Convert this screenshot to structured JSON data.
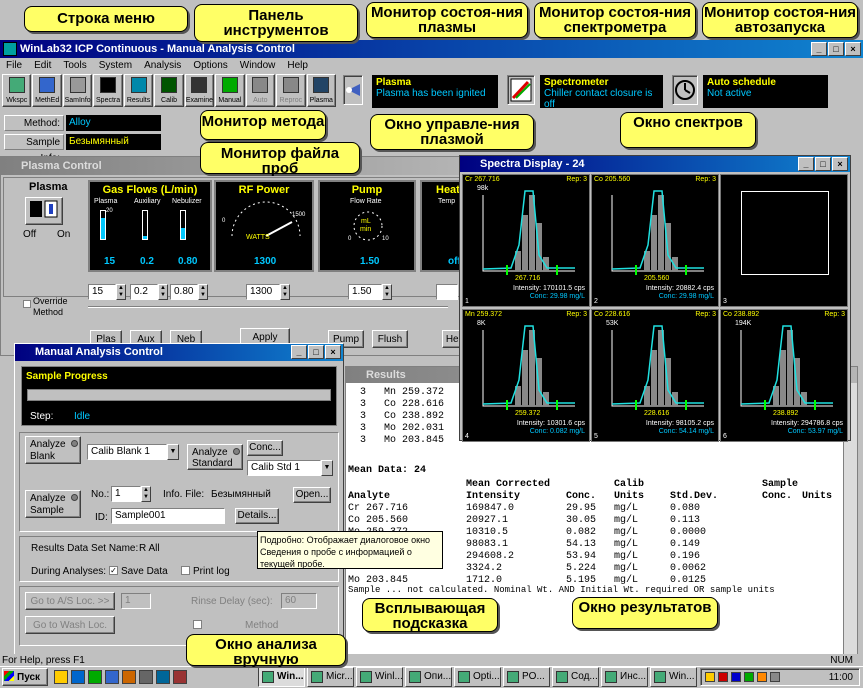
{
  "app_title": "WinLab32 ICP Continuous - Manual Analysis Control",
  "menu": [
    "File",
    "Edit",
    "Tools",
    "System",
    "Analysis",
    "Options",
    "Window",
    "Help"
  ],
  "toolbar": [
    "Wkspc",
    "MethEd",
    "SamInfo",
    "Spectra",
    "Results",
    "Calib",
    "Examine",
    "Manual",
    "Auto",
    "Reproc",
    "Plasma"
  ],
  "plasma_monitor": {
    "title": "Plasma",
    "status": "Plasma has been ignited"
  },
  "spectrometer_monitor": {
    "title": "Spectrometer",
    "status": "Chiller contact closure is off"
  },
  "auto_monitor": {
    "title": "Auto schedule",
    "status": "Not active"
  },
  "method": {
    "label": "Method:",
    "value": "Alloy"
  },
  "sample_info": {
    "label": "Sample Info:",
    "value": "Безымянный"
  },
  "plasma_control": {
    "title": "Plasma Control",
    "plasma_label": "Plasma",
    "off": "Off",
    "on": "On",
    "gas_title": "Gas Flows (L/min)",
    "gas_labels": [
      "Plasma",
      "Auxiliary",
      "Nebulizer"
    ],
    "gas_values": [
      "15",
      "0.2",
      "0.80"
    ],
    "gas_scale": [
      "20",
      "10",
      "0"
    ],
    "rf_title": "RF Power",
    "rf_unit": "WATTS",
    "rf_min": "0",
    "rf_max": "1500",
    "rf_value": "1300",
    "pump_title": "Pump",
    "pump_sub": "Flow Rate",
    "pump_unit": "mL",
    "pump_unit2": "min",
    "pump_min": "0",
    "pump_max": "10",
    "pump_value": "1.50",
    "heat_title": "Heat",
    "heat_sub": "Temp",
    "heat_value": "off",
    "spin_values": [
      "15",
      "0.2",
      "0.80",
      "1300",
      "1.50"
    ],
    "override": "Override Method",
    "buttons": [
      "Plas",
      "Aux",
      "Neb",
      "Apply",
      "Pump",
      "Flush",
      "Hea"
    ]
  },
  "spectra": {
    "title": "Spectra Display - 24",
    "cells": [
      {
        "wl": "Cr 267.716",
        "rep": "Rep: 3",
        "ymax": "98k",
        "peak": "267.716",
        "intensity": "Intensity: 170101.5 cps",
        "conc": "Conc: 29.98 mg/L",
        "n": "1"
      },
      {
        "wl": "Co 205.560",
        "rep": "Rep: 3",
        "ymax": "",
        "peak": "205.560",
        "intensity": "Intensity: 20882.4 cps",
        "conc": "Conc: 29.98 mg/L",
        "n": "2"
      },
      {
        "wl": "",
        "rep": "",
        "ymax": "",
        "peak": "",
        "intensity": "",
        "conc": "",
        "n": "3"
      },
      {
        "wl": "Mn 259.372",
        "rep": "Rep: 3",
        "ymax": "8K",
        "peak": "259.372",
        "intensity": "Intensity: 10301.6 cps",
        "conc": "Conc: 0.082 mg/L",
        "n": "4"
      },
      {
        "wl": "Co 228.616",
        "rep": "Rep: 3",
        "ymax": "53K",
        "peak": "228.616",
        "intensity": "Intensity: 98105.2 cps",
        "conc": "Conc: 54.14 mg/L",
        "n": "5"
      },
      {
        "wl": "Co 238.892",
        "rep": "Rep: 3",
        "ymax": "194K",
        "peak": "238.892",
        "intensity": "Intensity: 294786.8 cps",
        "conc": "Conc: 53.97 mg/L",
        "n": "6"
      }
    ]
  },
  "results": {
    "title": "Results",
    "top_rows": [
      [
        "3",
        "Mn 259.372"
      ],
      [
        "3",
        "Co 228.616"
      ],
      [
        "3",
        "Co 238.892"
      ],
      [
        "3",
        "Mo 202.031"
      ],
      [
        "3",
        "Mo 203.845"
      ]
    ],
    "mean_title": "Mean Data: 24",
    "h1": [
      "",
      "Mean Corrected",
      "",
      "Calib",
      "",
      "Sample"
    ],
    "h2": [
      "Analyte",
      "Intensity",
      "Conc.",
      "Units",
      "Std.Dev.",
      "Conc.",
      "Units"
    ],
    "rows": [
      [
        "Cr 267.716",
        "169847.0",
        "29.95",
        "mg/L",
        "0.080"
      ],
      [
        "Co 205.560",
        "20927.1",
        "30.05",
        "mg/L",
        "0.113"
      ],
      [
        "Mo 259.372",
        "10310.5",
        "0.082",
        "mg/L",
        "0.0000"
      ],
      [
        "",
        "98083.1",
        "54.13",
        "mg/L",
        "0.149"
      ],
      [
        "",
        "294608.2",
        "53.94",
        "mg/L",
        "0.196"
      ],
      [
        "",
        "3324.2",
        "5.224",
        "mg/L",
        "0.0062"
      ],
      [
        "Mo 203.845",
        "1712.0",
        "5.195",
        "mg/L",
        "0.0125"
      ]
    ],
    "footer": "Sample ... not calculated. Nominal Wt. AND Initial Wt. required OR sample units"
  },
  "manual": {
    "title": "Manual Analysis Control",
    "progress_title": "Sample Progress",
    "step_label": "Step:",
    "step_value": "Idle",
    "analyze_blank": "Analyze Blank",
    "blank_select": "Calib Blank 1",
    "analyze_standard": "Analyze Standard",
    "conc_btn": "Conc...",
    "std_select": "Calib Std 1",
    "analyze_sample": "Analyze Sample",
    "no_label": "No.:",
    "no_value": "1",
    "info_file_label": "Info. File:",
    "info_file_value": "Безымянный",
    "open_btn": "Open...",
    "id_label": "ID:",
    "id_value": "Sample001",
    "details_btn": "Details...",
    "results_name_label": "Results Data Set Name:",
    "results_name_value": "R All",
    "during_label": "During Analyses:",
    "save_data": "Save Data",
    "print_log": "Print log",
    "goto_as": "Go to A/S Loc. >>",
    "goto_as_value": "1",
    "delay_label": "Rinse Delay (sec):",
    "delay_value": "60",
    "goto_wash": "Go to Wash Loc.",
    "method_label": "Method"
  },
  "tooltip": "Подробно: Отображает диалоговое окно Сведения о пробе с информацией о текущей пробе.",
  "statusbar": {
    "help": "For Help, press F1",
    "num": "NUM"
  },
  "taskbar": {
    "start": "Пуск",
    "tasks": [
      "Win...",
      "Micr...",
      "Winl...",
      "Опи...",
      "Opti...",
      "PO...",
      "Сод...",
      "Инс...",
      "Win..."
    ],
    "clock": "11:00"
  },
  "callouts": {
    "menu": "Строка меню",
    "toolbar": "Панель инструментов",
    "plasma_mon": "Монитор состоя-ния плазмы",
    "spec_mon": "Монитор состоя-ния спектрометра",
    "auto_mon": "Монитор состоя-ния автозапуска",
    "method_mon": "Монитор метода",
    "sample_mon": "Монитор файла проб",
    "plasma_win": "Окно управле-ния плазмой",
    "spectra_win": "Окно спектров",
    "tooltip": "Всплывающая подсказка",
    "results_win": "Окно результатов",
    "manual_win": "Окно анализа вручную"
  }
}
